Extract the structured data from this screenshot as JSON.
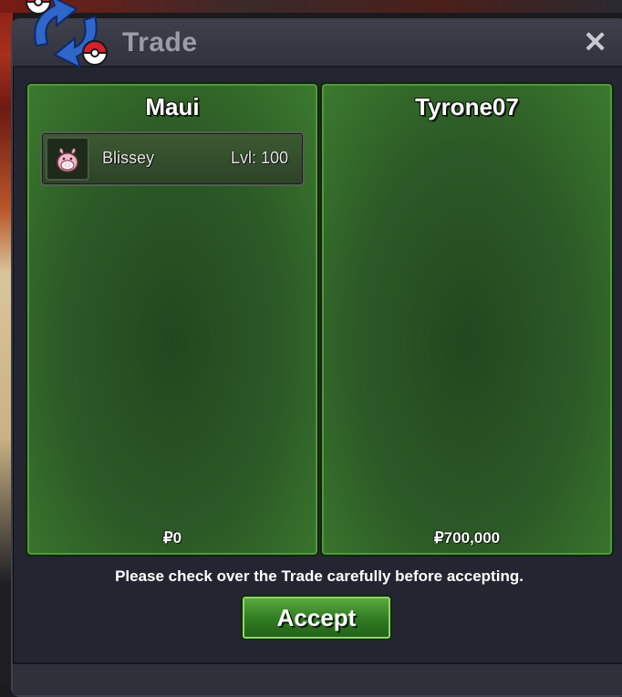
{
  "window": {
    "title": "Trade",
    "close_label": "✕",
    "logo_icon": "trade-swap-pokeballs-icon"
  },
  "trade": {
    "left": {
      "player_name": "Maui",
      "items": [
        {
          "name": "Blissey",
          "level": "Lvl: 100",
          "icon": "blissey-sprite-icon"
        }
      ],
      "money": "₽0"
    },
    "right": {
      "player_name": "Tyrone07",
      "items": [],
      "money": "₽700,000"
    }
  },
  "footer": {
    "notice": "Please check over the Trade carefully before accepting.",
    "accept_label": "Accept"
  },
  "colors": {
    "panel_green": "#2c5a26",
    "panel_border": "#4f9a3a",
    "window_bg": "#232531",
    "accept_green": "#2f7a22"
  }
}
